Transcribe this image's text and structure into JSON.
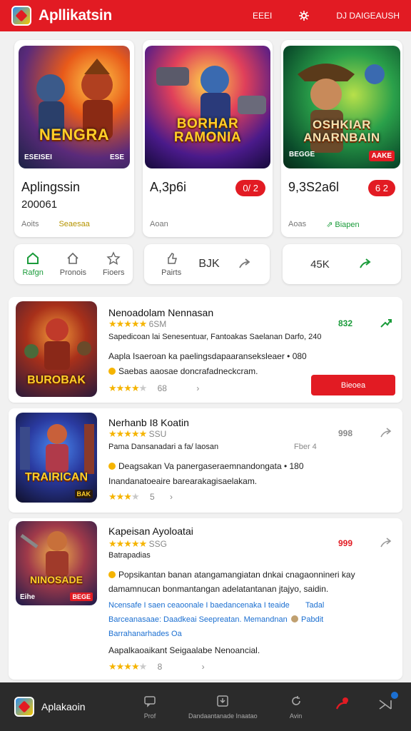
{
  "header": {
    "title": "Apllikatsin",
    "action1": "EEEI",
    "action2_icon": "settings-icon",
    "action3": "DJ DAIGEAUSH",
    "color": "#e21b23"
  },
  "featured": [
    {
      "art_title": "NENGRA",
      "art_left": "ESEISEI",
      "art_right": "ESE",
      "name": "Aplingssin",
      "sub": "200061",
      "meta1": "Aoits",
      "meta2": "Seaesaa"
    },
    {
      "art_title": "BORHAR RAMONIA",
      "name": "A,3p6i",
      "pill": "0/ 2",
      "meta1": "Aoan"
    },
    {
      "art_title": "OSHKIAR ANARNBAIN",
      "art_left": "BEGGE",
      "art_right": "AAKE",
      "name": "9,3S2a6l",
      "pill": "6 2",
      "meta1": "Aoas",
      "meta2": "Biapen"
    }
  ],
  "actions": [
    {
      "label": "Rafgn",
      "icon": "home-icon"
    },
    {
      "label": "Pronois",
      "icon": "share-house-icon"
    },
    {
      "label": "Fioers",
      "icon": "star-icon"
    },
    {
      "label": "Pairts",
      "icon": "thumb-icon"
    },
    {
      "label": "BJK",
      "icon": "text"
    },
    {
      "label": "",
      "icon": "share-icon"
    },
    {
      "label": "45K",
      "icon": "text"
    },
    {
      "label": "",
      "icon": "share-icon"
    }
  ],
  "items": [
    {
      "thumb_title": "BUROBAK",
      "title": "Nenoadolam Nennasan",
      "stars": "★★★★★",
      "score": "6SM",
      "tags": "Sapedicoan lai Senesentuar, Fantoakas Saelanan Darfo, 240",
      "desc": "Aapla Isaeroan ka paelingsdapaaranseksleaer • 080",
      "desc2": "Saebas aaosae doncrafadneckcram.",
      "stars2": "★★★★",
      "stars2_off": "★",
      "rating_count": "68",
      "value": "832",
      "btn": "Bieoea"
    },
    {
      "thumb_title": "TRAIRICAN",
      "thumb_tag": "BAK",
      "title": "Nerhanb I8 Koatin",
      "stars": "★★★★★",
      "score": "SSU",
      "tags": "Pama Dansanadari a fa/ laosan",
      "right_tag": "Fber 4",
      "desc": "Deagsakan Va panergaseraemnandongata • 180",
      "desc2": "Inandanatoeaire barearakagisaelakam.",
      "stars2": "★★★",
      "stars2_off": "★",
      "rating_count": "5",
      "value": "998"
    },
    {
      "thumb_title": "NINOSADE",
      "thumb_left": "Eihe",
      "thumb_tag": "BEGE",
      "title": "Kapeisan Ayoloatai",
      "stars": "★★★★★",
      "score": "SSG",
      "tags": "Batrapadias",
      "desc": "Popsikantan banan atangamangiatan dnkai cnagaonnineri kay",
      "desc2": "damamnucan bonmantangan adelatantanan jtajyo, saidin.",
      "link1": "Ncensafe I saen ceaoonale I baedancenaka I teaide",
      "link1_right": "Tadal",
      "link2": "Barceanasaae: Daadkeai Seepreatan. Memandnan",
      "link2_right": "Pabdit",
      "link3": "Barrahanarhades Oa",
      "desc3": "Aapalkaoaikant Seigaalabe Nenoancial.",
      "stars2": "★★★★",
      "stars2_off": "★",
      "rating_count": "8",
      "value": "999"
    }
  ],
  "bottom": {
    "title": "Aplakaoin",
    "nav": [
      "Prof",
      "Dandaantanade Inaatao",
      "Avin"
    ]
  }
}
